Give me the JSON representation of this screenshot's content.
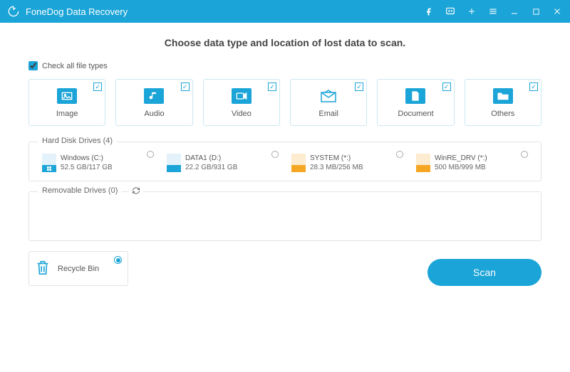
{
  "app": {
    "title": "FoneDog Data Recovery"
  },
  "heading": "Choose data type and location of lost data to scan.",
  "check_all_label": "Check all file types",
  "types": [
    {
      "label": "Image"
    },
    {
      "label": "Audio"
    },
    {
      "label": "Video"
    },
    {
      "label": "Email"
    },
    {
      "label": "Document"
    },
    {
      "label": "Others"
    }
  ],
  "hdd": {
    "title": "Hard Disk Drives (4)",
    "drives": [
      {
        "name": "Windows (C:)",
        "size": "52.5 GB/117 GB",
        "color": "#1ba4d7"
      },
      {
        "name": "DATA1 (D:)",
        "size": "22.2 GB/931 GB",
        "color": "#1ba4d7"
      },
      {
        "name": "SYSTEM (*:)",
        "size": "28.3 MB/256 MB",
        "color": "#f5a623"
      },
      {
        "name": "WinRE_DRV (*:)",
        "size": "500 MB/999 MB",
        "color": "#f5a623"
      }
    ]
  },
  "removable": {
    "title": "Removable Drives (0)"
  },
  "recycle": {
    "label": "Recycle Bin"
  },
  "scan_label": "Scan"
}
